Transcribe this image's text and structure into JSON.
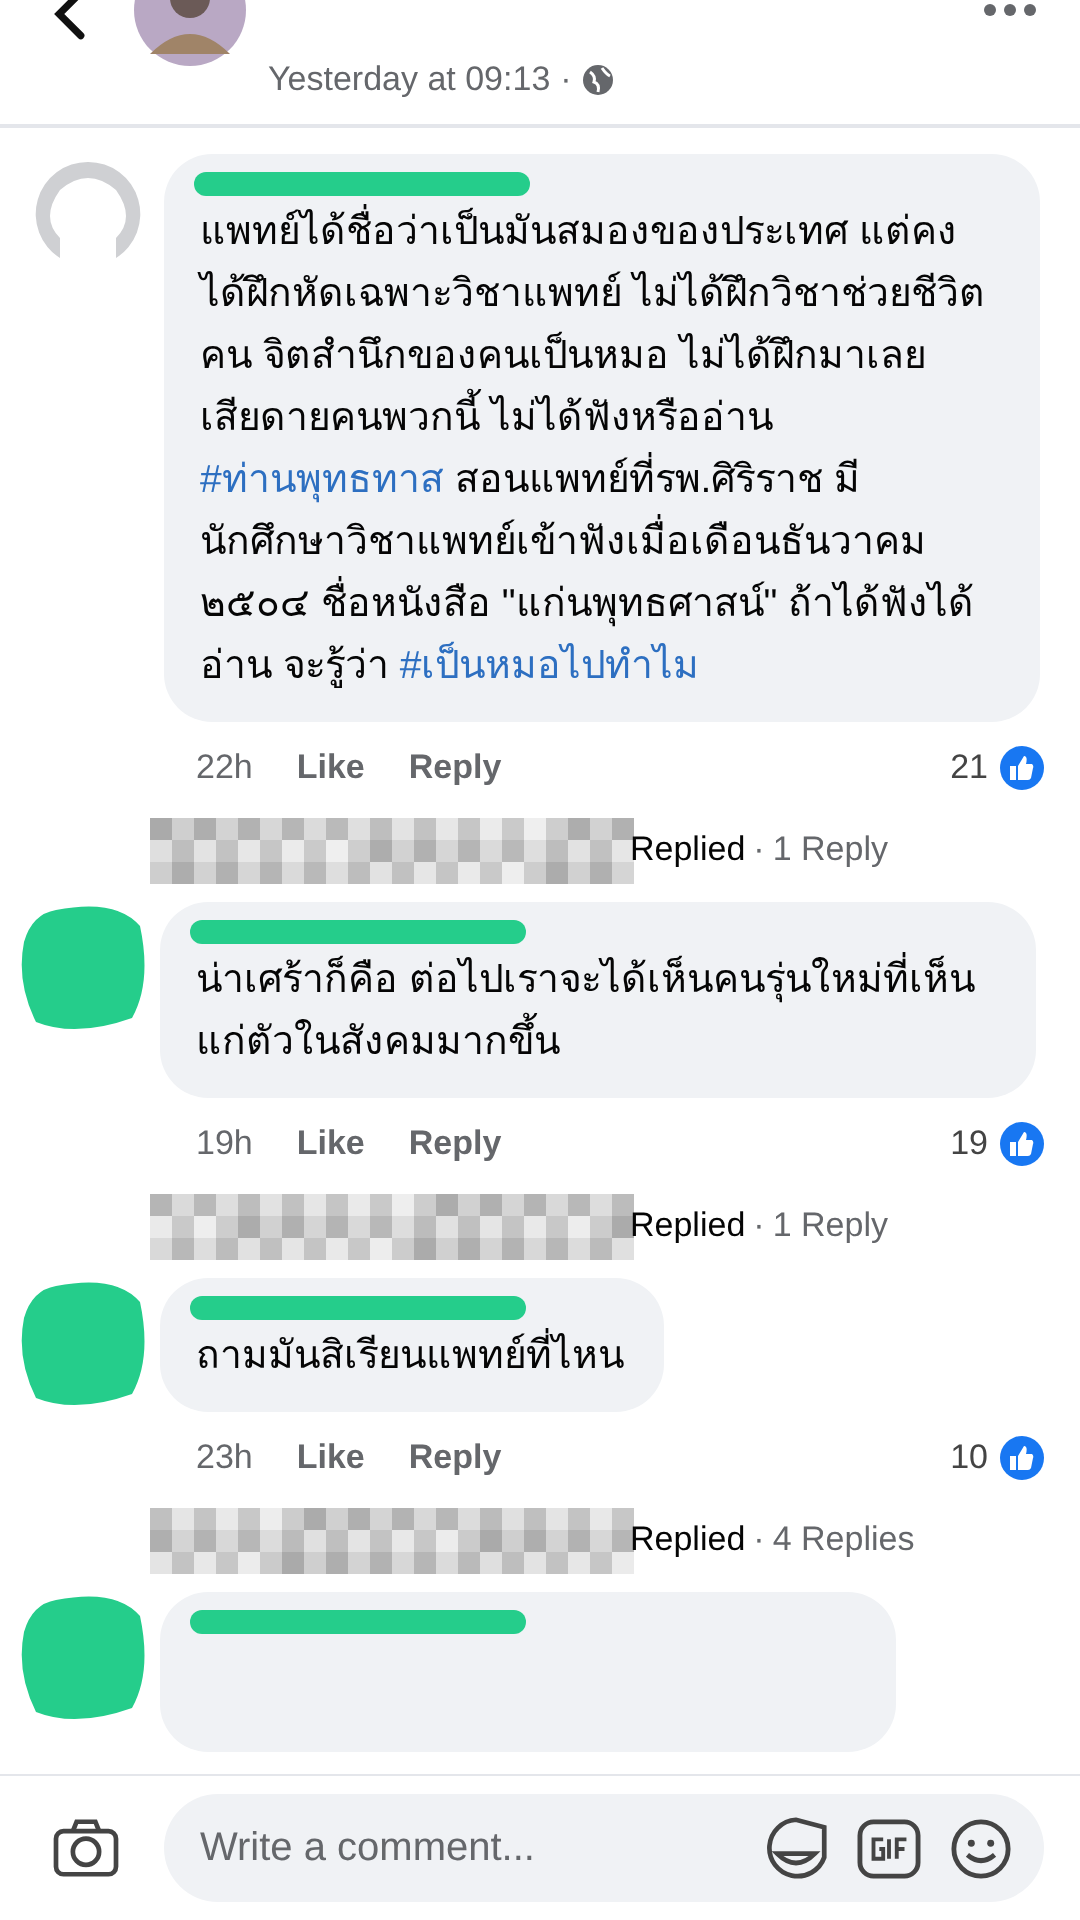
{
  "header": {
    "time": "Yesterday at 09:13",
    "separator": "·"
  },
  "comments": [
    {
      "avatar": {
        "kind": "placeholder"
      },
      "segments": [
        {
          "kind": "text",
          "text": "แพทย์ได้ชื่อว่าเป็นมันสมองของประเทศ แต่คงได้ฝึกหัดเฉพาะวิชาแพทย์ ไม่ได้ฝึกวิชาช่วยชีวิตคน จิตสำนึกของคนเป็นหมอ ไม่ได้ฝึกมาเลย เสียดายคนพวกนี้ ไม่ได้ฟังหรืออ่าน "
        },
        {
          "kind": "hashtag",
          "text": "#ท่านพุทธทาส"
        },
        {
          "kind": "text",
          "text": " สอนแพทย์ที่รพ.ศิริราช มีนักศึกษาวิชาแพทย์เข้าฟังเมื่อเดือนธันวาคม ๒๕๐๔ ชื่อหนังสือ \"แก่นพุทธศาสน์\" ถ้าได้ฟังได้อ่าน จะรู้ว่า "
        },
        {
          "kind": "hashtag",
          "text": "#เป็นหมอไปทำไม"
        }
      ],
      "time": "22h",
      "like": "Like",
      "reply": "Reply",
      "reactions": "21",
      "replies": {
        "label": "Replied",
        "separator": "·",
        "count": "1 Reply"
      }
    },
    {
      "avatar": {
        "kind": "redacted"
      },
      "segments": [
        {
          "kind": "text",
          "text": "น่าเศร้าก็คือ ต่อไปเราจะได้เห็นคนรุ่นใหม่ที่เห็นแก่ตัวในสังคมมากขึ้น"
        }
      ],
      "time": "19h",
      "like": "Like",
      "reply": "Reply",
      "reactions": "19",
      "replies": {
        "label": "Replied",
        "separator": "·",
        "count": "1 Reply"
      }
    },
    {
      "avatar": {
        "kind": "redacted"
      },
      "segments": [
        {
          "kind": "text",
          "text": "ถามมันสิเรียนแพทย์ที่ไหน"
        }
      ],
      "time": "23h",
      "like": "Like",
      "reply": "Reply",
      "reactions": "10",
      "replies": {
        "label": "Replied",
        "separator": "·",
        "count": "4 Replies"
      }
    },
    {
      "avatar": {
        "kind": "redacted"
      }
    }
  ],
  "composer": {
    "placeholder": "Write a comment..."
  }
}
